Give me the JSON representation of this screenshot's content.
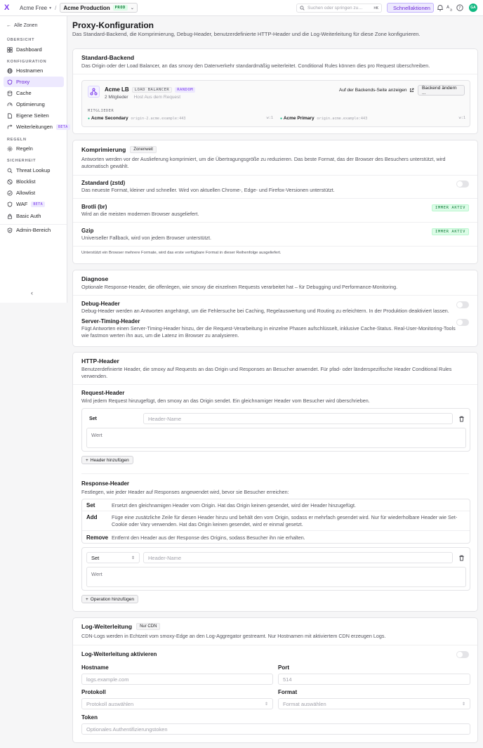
{
  "topbar": {
    "logo": "X",
    "org": "Acme Free",
    "env": "Acme Production",
    "env_badge": "PROD",
    "search_placeholder": "Suchen oder springen zu…",
    "search_kbd": "⌘K",
    "quick": "Schnellaktionen",
    "avatar": "GA"
  },
  "sidebar": {
    "back": "Alle Zonen",
    "sections": [
      "ÜBERSICHT",
      "KONFIGURATION",
      "REGELN",
      "SICHERHEIT"
    ],
    "items": [
      "Dashboard",
      "Hostnamen",
      "Proxy",
      "Cache",
      "Optimierung",
      "Eigene Seiten",
      "Weiterleitungen",
      "Regeln",
      "Threat Lookup",
      "Blocklist",
      "Allowlist",
      "WAF",
      "Basic Auth",
      "Admin-Bereich"
    ],
    "beta": "BETA",
    "collapse": "‹"
  },
  "page": {
    "title": "Proxy-Konfiguration",
    "subtitle": "Das Standard-Backend, die Komprimierung, Debug-Header, benutzerdefinierte HTTP-Header und die Log-Weiterleitung für diese Zone konfigurieren."
  },
  "backend": {
    "title": "Standard-Backend",
    "desc": "Das Origin oder der Load Balancer, an das smoxy den Datenverkehr standardmäßig weiterleitet. Conditional Rules können dies pro Request überschreiben.",
    "name": "Acme LB",
    "badge1": "LOAD BALANCER",
    "badge2": "RANDOM",
    "members_count": "2 Mitglieder",
    "host_label": "Host",
    "host_value": "Aus dem Request",
    "link": "Auf der Backends-Seite anzeigen",
    "change": "Backend ändern ...",
    "members_label": "MITGLIEDER",
    "members": [
      {
        "name": "Acme Secondary",
        "host": "origin-2.acme.example:443",
        "weight": "w:1"
      },
      {
        "name": "Acme Primary",
        "host": "origin.acme.example:443",
        "weight": "w:1"
      }
    ]
  },
  "compression": {
    "title": "Komprimierung",
    "tag": "Zonenweit",
    "desc": "Antworten werden vor der Auslieferung komprimiert, um die Übertragungsgröße zu reduzieren. Das beste Format, das der Browser des Besuchers unterstützt, wird automatisch gewählt.",
    "items": [
      {
        "name": "Zstandard (zstd)",
        "desc": "Das neueste Format, kleiner und schneller. Wird von aktuellen Chrome-, Edge- und Firefox-Versionen unterstützt."
      },
      {
        "name": "Brotli (br)",
        "desc": "Wird an die meisten modernen Browser ausgeliefert.",
        "badge": "IMMER AKTIV"
      },
      {
        "name": "Gzip",
        "desc": "Universeller Fallback, wird von jedem Browser unterstützt.",
        "badge": "IMMER AKTIV"
      }
    ],
    "note": "Unterstützt ein Browser mehrere Formate, wird das erste verfügbare Format in dieser Reihenfolge ausgeliefert."
  },
  "diagnose": {
    "title": "Diagnose",
    "desc": "Optionale Response-Header, die offenlegen, wie smoxy die einzelnen Requests verarbeitet hat – für Debugging und Performance-Monitoring.",
    "items": [
      {
        "name": "Debug-Header",
        "desc": "Debug-Header werden an Antworten angehängt, um die Fehlersuche bei Caching, Regelauswertung und Routing zu erleichtern. In der Produktion deaktiviert lassen."
      },
      {
        "name": "Server-Timing-Header",
        "desc": "Fügt Antworten einen Server-Timing-Header hinzu, der die Request-Verarbeitung in einzelne Phasen aufschlüsselt, inklusive Cache-Status. Real-User-Monitoring-Tools wie fastmon werten ihn aus, um die Latenz im Browser zu analysieren."
      }
    ]
  },
  "http": {
    "title": "HTTP-Header",
    "desc": "Benutzerdefinierte Header, die smoxy auf Requests an das Origin und Responses an Besucher anwendet. Für pfad- oder länderspezifische Header Conditional Rules verwenden.",
    "req_title": "Request-Header",
    "req_desc": "Wird jedem Request hinzugefügt, den smoxy an das Origin sendet. Ein gleichnamiger Header vom Besucher wird überschrieben.",
    "req_op": "Set",
    "name_ph": "Header-Name",
    "value_ph": "Wert",
    "add_header": "Header hinzufügen",
    "res_title": "Response-Header",
    "res_desc": "Festlegen, wie jeder Header auf Responses angewendet wird, bevor sie Besucher erreichen:",
    "ops": [
      {
        "k": "Set",
        "v": "Ersetzt den gleichnamigen Header vom Origin. Hat das Origin keinen gesendet, wird der Header hinzugefügt."
      },
      {
        "k": "Add",
        "v": "Füge eine zusätzliche Zeile für diesen Header hinzu und behält den vom Origin, sodass er mehrfach gesendet wird. Nur für wiederholbare Header wie Set-Cookie oder Vary verwenden. Hat das Origin keinen gesendet, wird er einmal gesetzt."
      },
      {
        "k": "Remove",
        "v": "Entfernt den Header aus der Response des Origins, sodass Besucher ihn nie erhalten."
      }
    ],
    "res_select": "Set",
    "add_op": "Operation hinzufügen"
  },
  "log": {
    "title": "Log-Weiterleitung",
    "tag": "Nur CDN",
    "desc": "CDN-Logs werden in Echtzeit vom smoxy-Edge an den Log-Aggregator gestreamt. Nur Hostnamen mit aktiviertem CDN erzeugen Logs.",
    "enable": "Log-Weiterleitung aktivieren",
    "host_label": "Hostname",
    "host_ph": "logs.example.com",
    "port_label": "Port",
    "port_ph": "514",
    "proto_label": "Protokoll",
    "proto_ph": "Protokoll auswählen",
    "format_label": "Format",
    "format_ph": "Format auswählen",
    "token_label": "Token",
    "token_ph": "Optionales Authentifizierungstoken"
  },
  "colors": {
    "accent": "#7c3aed",
    "success": "#15803d"
  }
}
